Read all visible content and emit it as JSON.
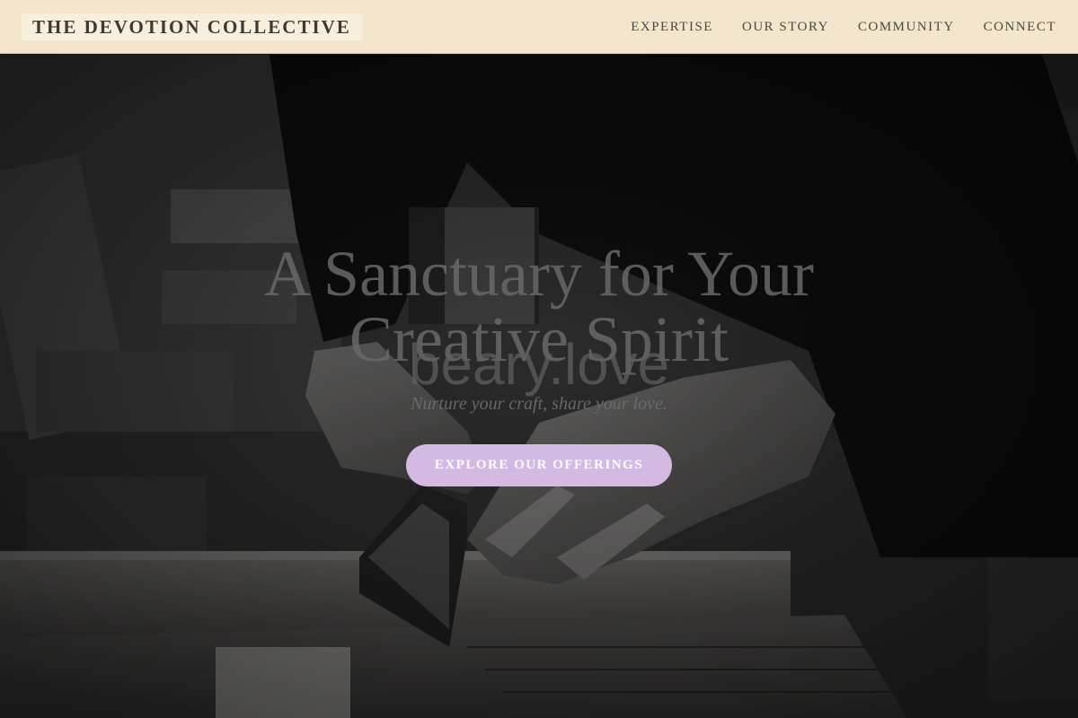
{
  "header": {
    "brand": "THE DEVOTION COLLECTIVE",
    "nav": [
      {
        "label": "EXPERTISE"
      },
      {
        "label": "OUR STORY"
      },
      {
        "label": "COMMUNITY"
      },
      {
        "label": "CONNECT"
      }
    ]
  },
  "hero": {
    "title_line1": "A Sanctuary for Your",
    "title_line2": "Creative Spirit",
    "domain": "beary.love",
    "tagline": "Nurture your craft, share your love.",
    "cta_label": "EXPLORE OUR OFFERINGS"
  },
  "colors": {
    "header_bg": "#f3e6cc",
    "cta_bg": "#d4b9e2",
    "cta_text": "#ffffff",
    "brand_text": "#3b3a37"
  }
}
